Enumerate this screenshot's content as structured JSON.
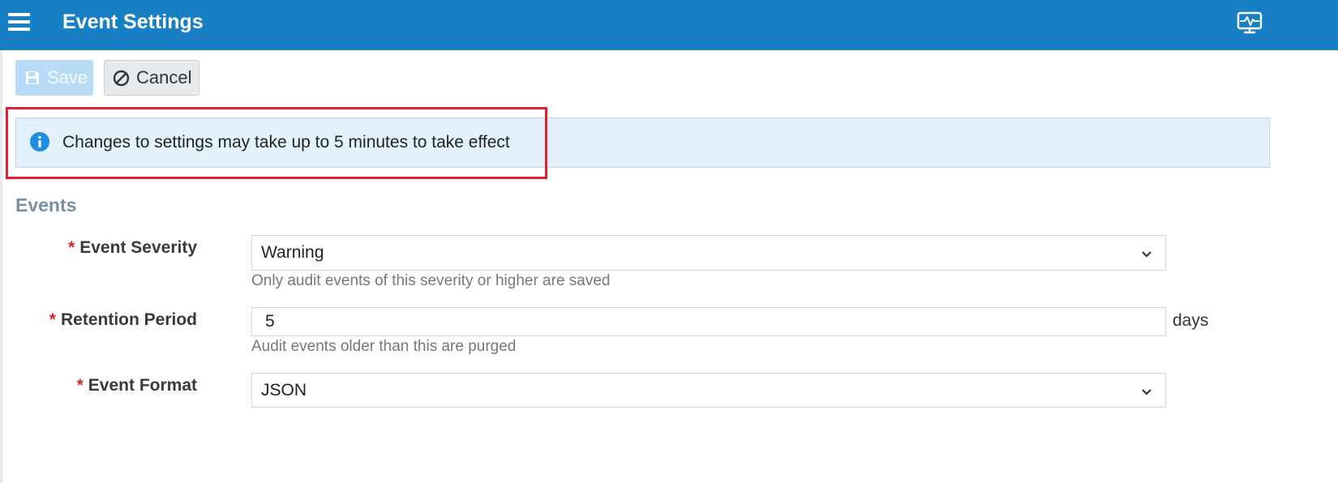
{
  "header": {
    "title": "Event Settings",
    "menu_icon": "hamburger-menu-icon",
    "monitor_icon": "monitor-activity-icon",
    "background_color": "#177fc4"
  },
  "toolbar": {
    "save_label": "Save",
    "save_icon": "floppy-disk-icon",
    "save_enabled": false,
    "cancel_label": "Cancel",
    "cancel_icon": "ban-circle-icon"
  },
  "alert": {
    "icon": "info-circle-icon",
    "text": "Changes to settings may take up to 5 minutes to take effect",
    "highlight_color": "#e0202a"
  },
  "section": {
    "title": "Events"
  },
  "fields": {
    "severity": {
      "required_mark": "*",
      "label": "Event Severity",
      "value": "Warning",
      "help": "Only audit events of this severity or higher are saved"
    },
    "retention": {
      "required_mark": "*",
      "label": "Retention Period",
      "value": "5",
      "unit": "days",
      "help": "Audit events older than this are purged"
    },
    "format": {
      "required_mark": "*",
      "label": "Event Format",
      "value": "JSON"
    }
  }
}
